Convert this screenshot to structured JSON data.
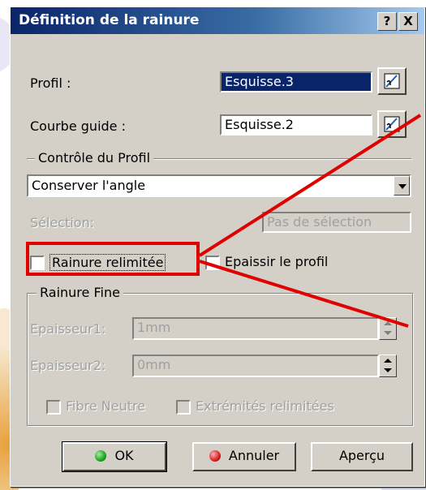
{
  "dialog": {
    "title": "Définition de la rainure",
    "help_label": "?",
    "close_label": "X"
  },
  "profile": {
    "label": "Profil :",
    "value": "Esquisse.3"
  },
  "guide": {
    "label": "Courbe guide :",
    "value": "Esquisse.2"
  },
  "profile_control": {
    "title": "Contrôle du Profil",
    "mode": "Conserver l'angle",
    "selection_label": "Sélection:",
    "selection_value": "Pas de sélection"
  },
  "options": {
    "limited": "Rainure relimitée",
    "thicken": "Epaissir le profil"
  },
  "thin_groove": {
    "title": "Rainure Fine",
    "thickness1_label": "Epaisseur1:",
    "thickness1_value": "1mm",
    "thickness2_label": "Epaisseur2:",
    "thickness2_value": "0mm",
    "neutral_fiber": "Fibre Neutre",
    "limited_ends": "Extrémités relimitées"
  },
  "buttons": {
    "ok": "OK",
    "cancel": "Annuler",
    "preview": "Aperçu"
  },
  "colors": {
    "highlight": "#e00000",
    "ok_dot": "#1aa31a",
    "cancel_dot": "#d42020"
  }
}
